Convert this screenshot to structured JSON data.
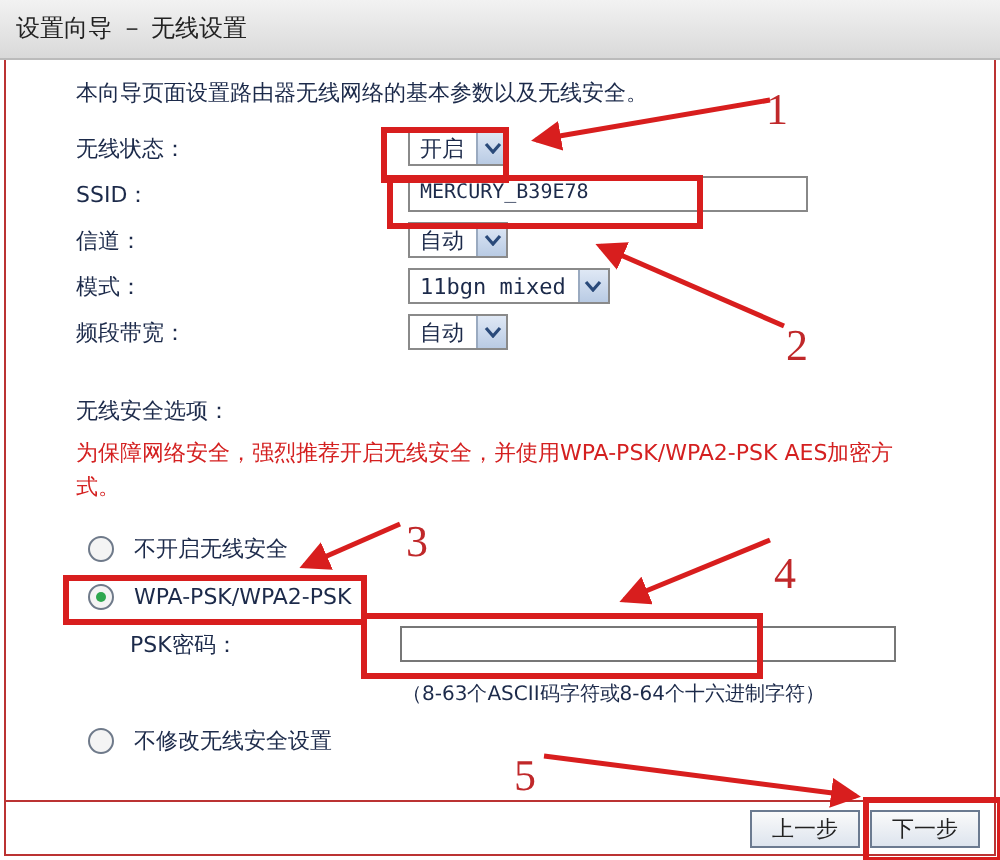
{
  "window": {
    "title": "设置向导 － 无线设置"
  },
  "intro": "本向导页面设置路由器无线网络的基本参数以及无线安全。",
  "fields": [
    {
      "kind": "select",
      "label": "无线状态：",
      "value": "开启"
    },
    {
      "kind": "text",
      "label": "SSID：",
      "value": "MERCURY_B39E78"
    },
    {
      "kind": "select",
      "label": "信道：",
      "value": "自动"
    },
    {
      "kind": "select",
      "label": "模式：",
      "value": "11bgn mixed"
    },
    {
      "kind": "select",
      "label": "频段带宽：",
      "value": "自动"
    }
  ],
  "security": {
    "heading": "无线安全选项：",
    "warning": "为保障网络安全，强烈推荐开启无线安全，并使用WPA-PSK/WPA2-PSK AES加密方式。",
    "options": [
      {
        "label": "不开启无线安全",
        "selected": false
      },
      {
        "label": "WPA-PSK/WPA2-PSK",
        "selected": true,
        "password_label": "PSK密码：",
        "hint": "（8-63个ASCII码字符或8-64个十六进制字符）"
      },
      {
        "label": "不修改无线安全设置",
        "selected": false
      }
    ]
  },
  "buttons": [
    "上一步",
    "下一步"
  ],
  "annotations": [
    {
      "label": "1"
    },
    {
      "label": "2"
    },
    {
      "label": "3"
    },
    {
      "label": "4"
    },
    {
      "label": "5"
    }
  ]
}
